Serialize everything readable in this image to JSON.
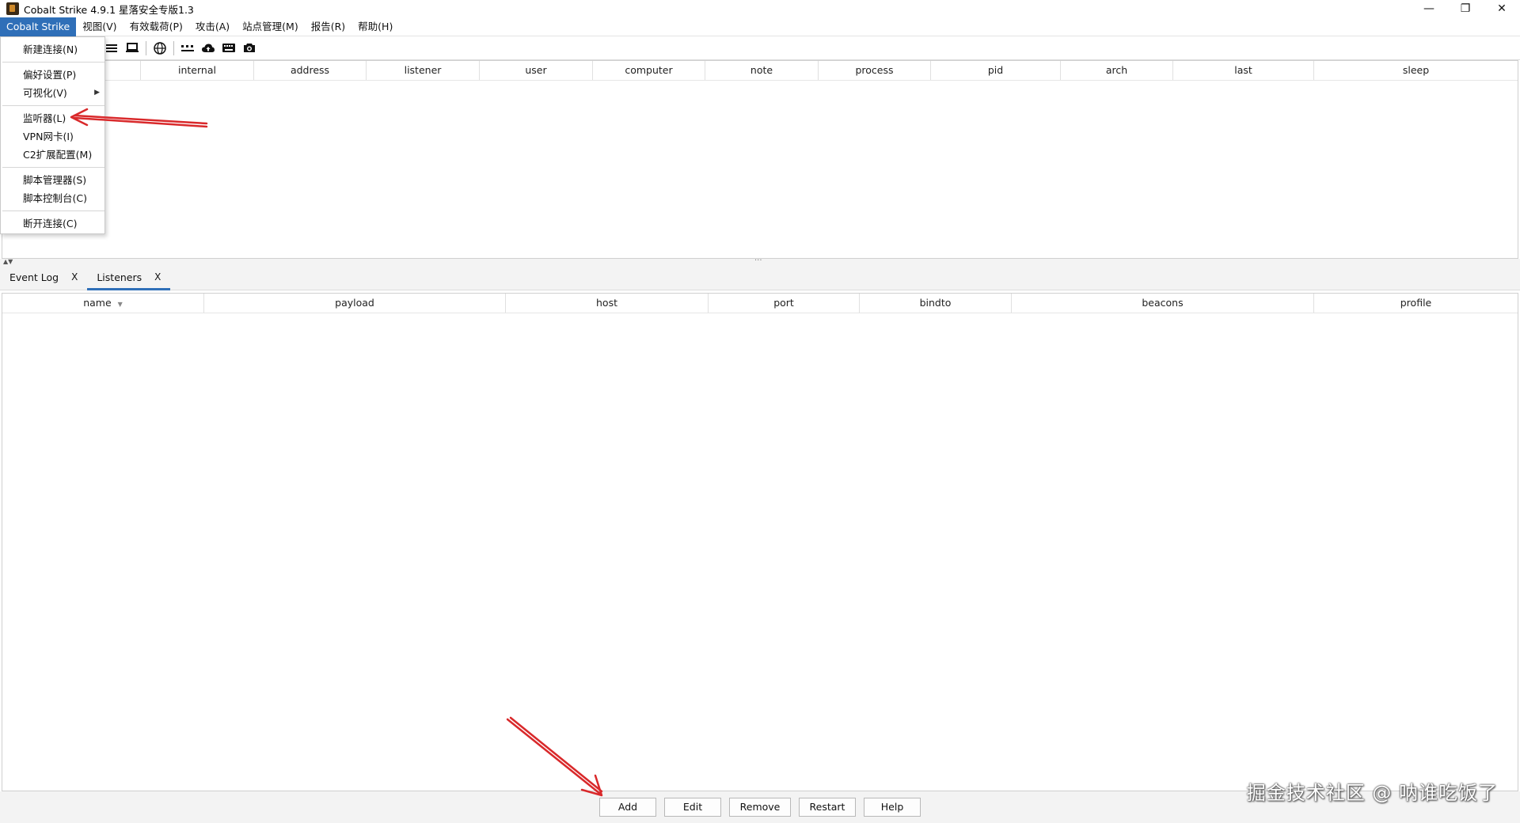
{
  "window": {
    "title": "Cobalt Strike 4.9.1 星落安全专版1.3",
    "minimize": "—",
    "restore": "❐",
    "close": "✕"
  },
  "menubar": {
    "items": [
      "Cobalt Strike",
      "视图(V)",
      "有效载荷(P)",
      "攻击(A)",
      "站点管理(M)",
      "报告(R)",
      "帮助(H)"
    ]
  },
  "toolbar": {
    "icons": [
      "list-icon",
      "monitor-icon",
      "globe-icon",
      "network-icon",
      "cloud-upload-icon",
      "keyboard-icon",
      "camera-icon"
    ]
  },
  "sessions_table": {
    "columns": [
      "",
      "internal",
      "address",
      "listener",
      "user",
      "computer",
      "note",
      "process",
      "pid",
      "arch",
      "last",
      "sleep"
    ]
  },
  "dropdown": {
    "items": {
      "new_connection": "新建连接(N)",
      "preferences": "偏好设置(P)",
      "visualization": "可视化(V)",
      "listeners": "监听器(L)",
      "vpn": "VPN网卡(I)",
      "c2_ext": "C2扩展配置(M)",
      "script_manager": "脚本管理器(S)",
      "script_console": "脚本控制台(C)",
      "disconnect": "断开连接(C)"
    }
  },
  "tabs": [
    {
      "label": "Event Log",
      "close": "X"
    },
    {
      "label": "Listeners",
      "close": "X"
    }
  ],
  "listeners_table": {
    "columns": [
      "name",
      "payload",
      "host",
      "port",
      "bindto",
      "beacons",
      "profile"
    ]
  },
  "buttons": {
    "add": "Add",
    "edit": "Edit",
    "remove": "Remove",
    "restart": "Restart",
    "help": "Help"
  },
  "watermark": "掘金技术社区 @ 呐谁吃饭了",
  "colors": {
    "accent": "#2f6fb8",
    "annotation_arrow": "#d9292b"
  }
}
